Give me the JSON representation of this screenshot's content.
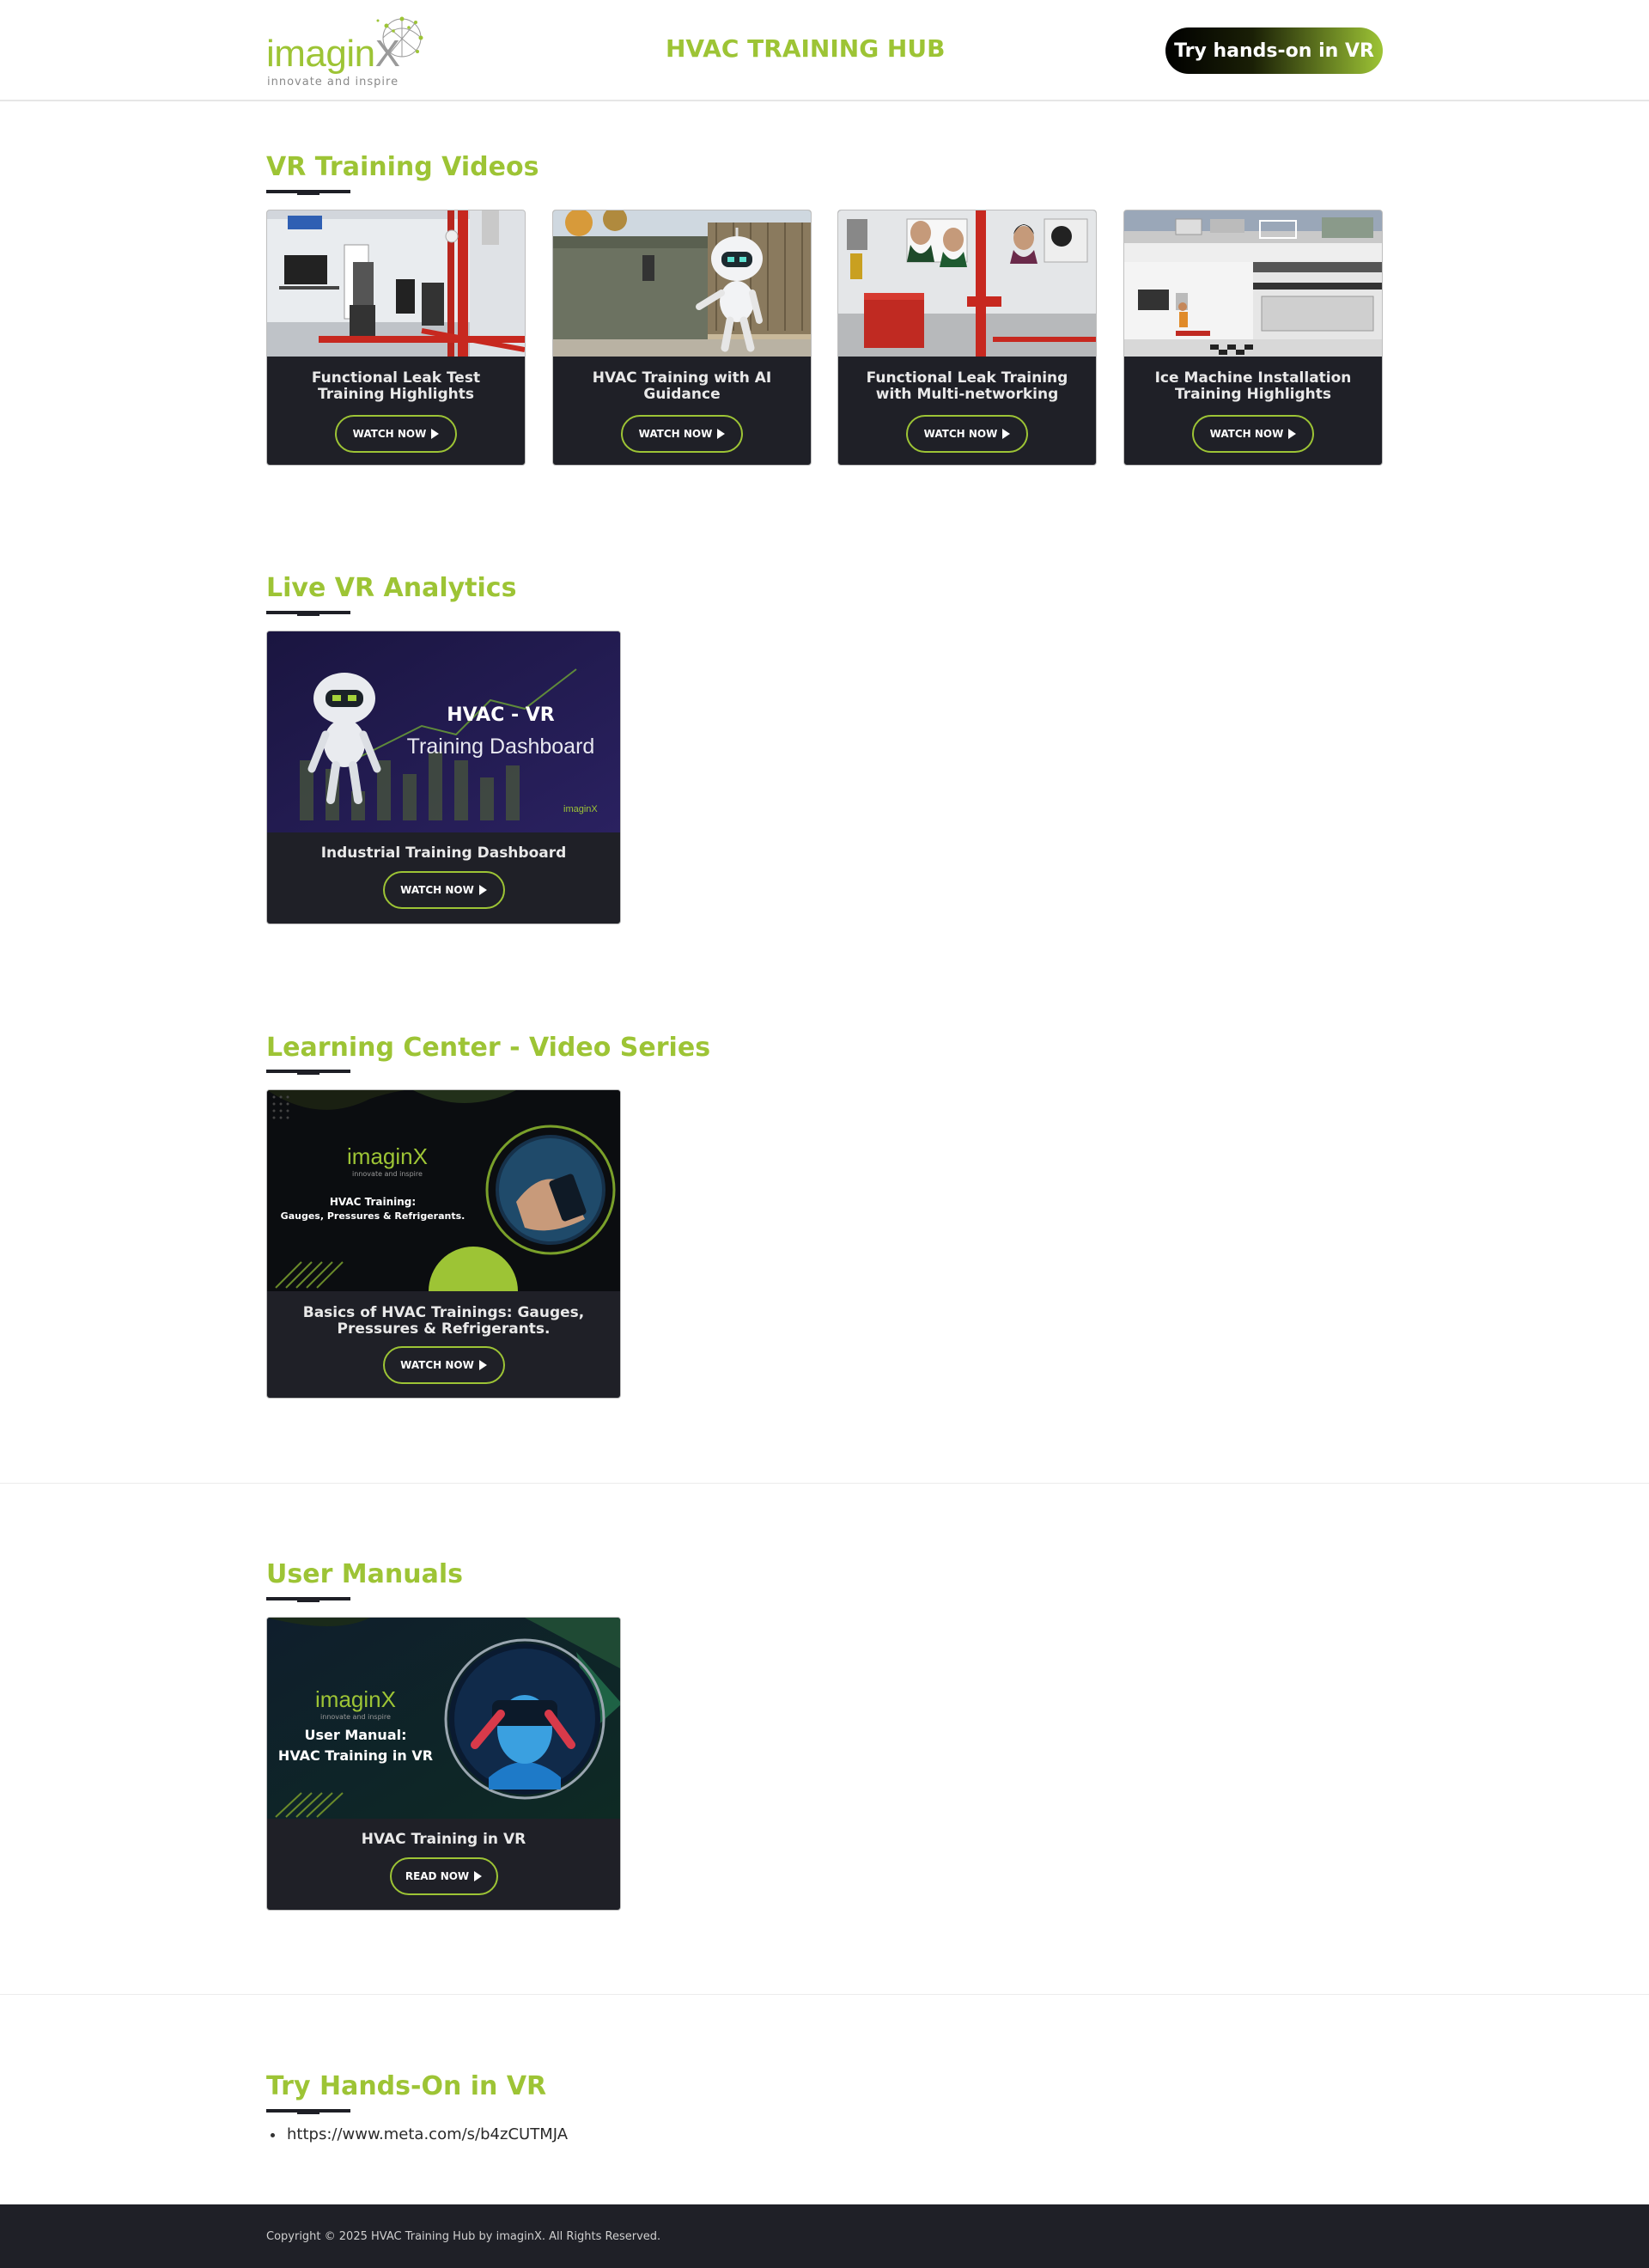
{
  "header": {
    "logo_text": "imagin",
    "logo_x": "X",
    "logo_tagline": "innovate and inspire",
    "title": "HVAC TRAINING HUB",
    "cta_label": "Try hands-on in VR"
  },
  "sections": {
    "vr_videos": {
      "title": "VR Training Videos",
      "cards": [
        {
          "title": "Functional Leak Test Training Highlights",
          "button": "WATCH NOW"
        },
        {
          "title": "HVAC Training with AI Guidance",
          "button": "WATCH NOW"
        },
        {
          "title": "Functional Leak Training with Multi-networking",
          "button": "WATCH NOW"
        },
        {
          "title": "Ice Machine Installation Training Highlights",
          "button": "WATCH NOW"
        }
      ]
    },
    "analytics": {
      "title": "Live VR Analytics",
      "card": {
        "title": "Industrial Training Dashboard",
        "button": "WATCH NOW",
        "thumb_heading": "HVAC - VR",
        "thumb_sub": "Training Dashboard",
        "thumb_logo": "imaginX"
      }
    },
    "learning": {
      "title": "Learning Center - Video Series",
      "card": {
        "title": "Basics of HVAC Trainings: Gauges, Pressures & Refrigerants.",
        "button": "WATCH NOW",
        "thumb_logo": "imaginX",
        "thumb_tagline": "innovate and inspire",
        "thumb_line1": "HVAC Training:",
        "thumb_line2": "Gauges, Pressures & Refrigerants."
      }
    },
    "manuals": {
      "title": "User Manuals",
      "card": {
        "title": "HVAC Training in VR",
        "button": "READ NOW",
        "thumb_logo": "imaginX",
        "thumb_tagline": "innovate and inspire",
        "thumb_line1": "User Manual:",
        "thumb_line2": "HVAC Training in VR"
      }
    },
    "hands_on": {
      "title": "Try Hands-On in VR",
      "links": [
        "https://www.meta.com/s/b4zCUTMJA"
      ]
    }
  },
  "footer": {
    "copyright": "Copyright © 2025 HVAC Training Hub by imaginX. All Rights Reserved."
  },
  "colors": {
    "accent": "#9dc435",
    "dark": "#1f2027",
    "text": "#1e1f26"
  }
}
